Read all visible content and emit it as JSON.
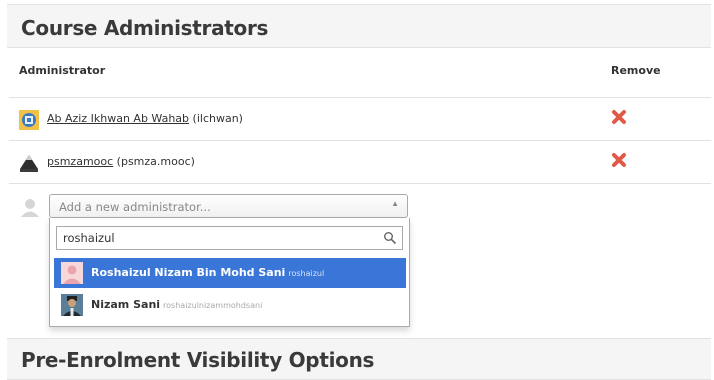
{
  "section1": {
    "title": "Course Administrators"
  },
  "table": {
    "col_administrator": "Administrator",
    "col_remove": "Remove"
  },
  "admins": [
    {
      "display_name": "Ab Aziz Ikhwan Ab Wahab",
      "username": "(ilchwan)",
      "avatar_icon": "gear-badge-icon"
    },
    {
      "display_name": "psmzamooc",
      "username": "(psmza.mooc)",
      "avatar_icon": "mountain-logo-icon"
    }
  ],
  "add_admin": {
    "placeholder": "Add a new administrator...",
    "search_value": "roshaizul",
    "options": [
      {
        "name": "Roshaizul Nizam Bin Mohd Sani",
        "username": "roshaizul",
        "selected": true
      },
      {
        "name": "Nizam Sani",
        "username": "roshaizulnizammohdsani",
        "selected": false
      }
    ]
  },
  "section2": {
    "title": "Pre-Enrolment Visibility Options"
  },
  "colors": {
    "remove": "#e05a47",
    "highlight": "#3a76d8"
  }
}
